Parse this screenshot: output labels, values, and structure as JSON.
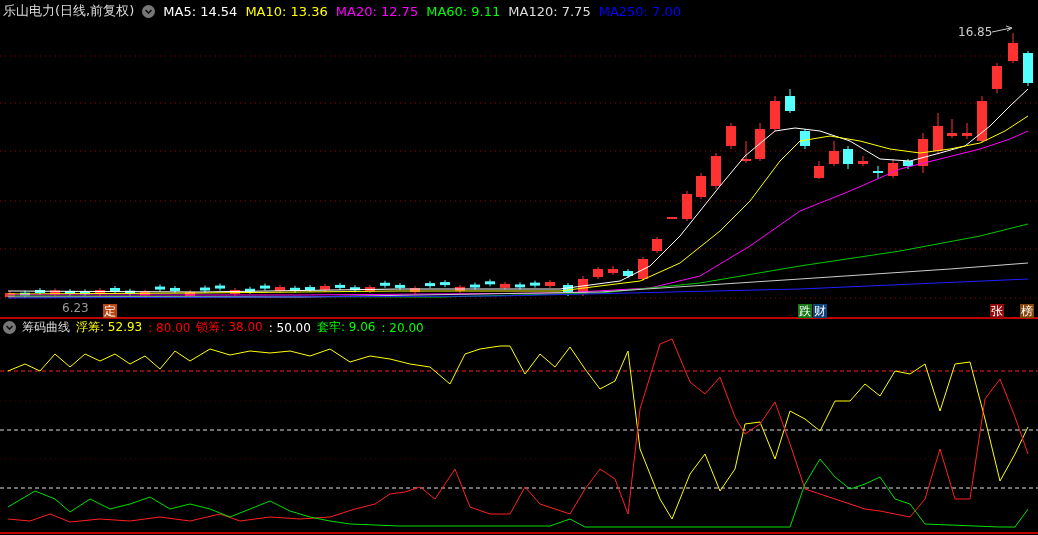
{
  "header": {
    "title": "乐山电力(日线,前复权)",
    "ma": [
      {
        "label": "MA5: 14.54",
        "color": "#ffffff"
      },
      {
        "label": "MA10: 13.36",
        "color": "#ffff00"
      },
      {
        "label": "MA20: 12.75",
        "color": "#ff00ff"
      },
      {
        "label": "MA60: 9.11",
        "color": "#00ff00"
      },
      {
        "label": "MA120: 7.75",
        "color": "#dddddd"
      },
      {
        "label": "MA250: 7.00",
        "color": "#0000ff"
      }
    ]
  },
  "price_chart": {
    "high_label": "16.85",
    "low_label": "6.23",
    "markers": [
      {
        "text": "定",
        "color": "#b8460e"
      },
      {
        "text": "跌",
        "color": "#187818"
      },
      {
        "text": "财",
        "color": "#0e4478"
      },
      {
        "text": "张",
        "color": "#8e0c0c"
      },
      {
        "text": "榜",
        "color": "#84460e"
      }
    ]
  },
  "indicator": {
    "title": "筹码曲线",
    "values": [
      {
        "text": "浮筹: 52.93",
        "color": "#ffff00"
      },
      {
        "text": ": 80.00",
        "color": "#ff0000"
      },
      {
        "text": "锁筹: 38.00",
        "color": "#ff0000"
      },
      {
        "text": ": 50.00",
        "color": "#ffffff"
      },
      {
        "text": "套牢: 9.06",
        "color": "#00ff00"
      },
      {
        "text": ": 20.00",
        "color": "#00ff00"
      }
    ]
  }
}
